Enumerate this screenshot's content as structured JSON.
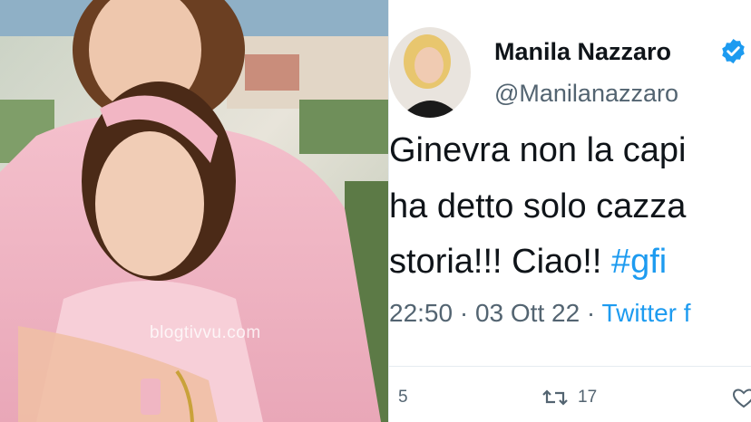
{
  "photo": {
    "watermark": "blogtivvu.com"
  },
  "tweet": {
    "author_name": "Manila Nazzaro",
    "handle": "@Manilanazzaro",
    "text_lines": [
      "Ginevra non la capi",
      "ha detto solo cazza",
      "storia!!! Ciao!! "
    ],
    "hashtag": "#gfi",
    "time": "22:50",
    "dot": " · ",
    "date": "03 Ott 22",
    "source": "Twitter f",
    "reply_count": "5",
    "retweet_count": "17",
    "accent_color": "#1d9bf0",
    "icons": {
      "verified": "verified-badge-icon",
      "reply": "reply-icon",
      "retweet": "retweet-icon",
      "like": "heart-icon"
    }
  }
}
